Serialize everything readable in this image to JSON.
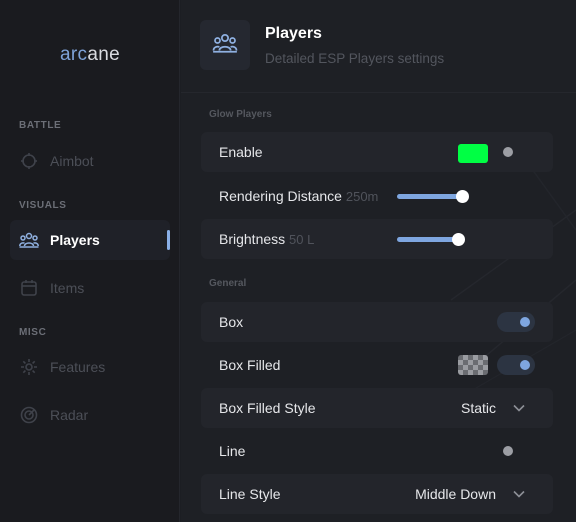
{
  "sidebar": {
    "logo_accent": "arc",
    "logo_rest": "ane",
    "sections": {
      "battle": "BATTLE",
      "visuals": "VISUALS",
      "misc": "MISC"
    },
    "items": {
      "aimbot": {
        "label": "Aimbot",
        "icon": "crosshair-icon"
      },
      "players": {
        "label": "Players",
        "icon": "users-icon",
        "active": true
      },
      "items": {
        "label": "Items",
        "icon": "calendar-icon"
      },
      "features": {
        "label": "Features",
        "icon": "gear-icon"
      },
      "radar": {
        "label": "Radar",
        "icon": "radar-icon"
      }
    }
  },
  "header": {
    "icon": "users-icon",
    "title": "Players",
    "subtitle": "Detailed ESP Players settings"
  },
  "groups": {
    "glow": {
      "label": "Glow Players",
      "enable": {
        "label": "Enable",
        "color": "#00ff44",
        "toggle": false
      },
      "rendering_distance": {
        "label": "Rendering Distance",
        "value": "250m",
        "fill": 0.66
      },
      "brightness": {
        "label": "Brightness",
        "value": "50 L",
        "fill": 0.64
      }
    },
    "general": {
      "label": "General",
      "box": {
        "label": "Box",
        "toggle": true
      },
      "box_filled": {
        "label": "Box Filled",
        "toggle": true
      },
      "box_filled_style": {
        "label": "Box Filled Style",
        "selected": "Static"
      },
      "line": {
        "label": "Line",
        "toggle": false
      },
      "line_style": {
        "label": "Line Style",
        "selected": "Middle Down"
      }
    }
  },
  "colors": {
    "accent": "#7ea6e0",
    "swatch": "#00ff44"
  }
}
